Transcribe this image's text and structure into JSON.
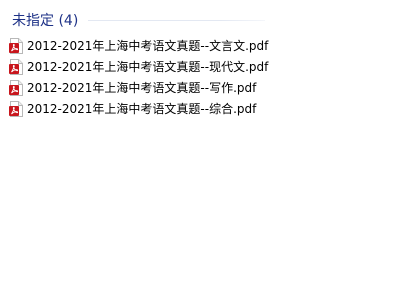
{
  "group": {
    "title": "未指定 (4)"
  },
  "files": [
    {
      "name": "2012-2021年上海中考语文真题--文言文.pdf",
      "icon": "pdf-file-icon"
    },
    {
      "name": "2012-2021年上海中考语文真题--现代文.pdf",
      "icon": "pdf-file-icon"
    },
    {
      "name": "2012-2021年上海中考语文真题--写作.pdf",
      "icon": "pdf-file-icon"
    },
    {
      "name": "2012-2021年上海中考语文真题--综合.pdf",
      "icon": "pdf-file-icon"
    }
  ],
  "colors": {
    "group_title": "#1e3287",
    "pdf_icon_red": "#c8161d"
  }
}
